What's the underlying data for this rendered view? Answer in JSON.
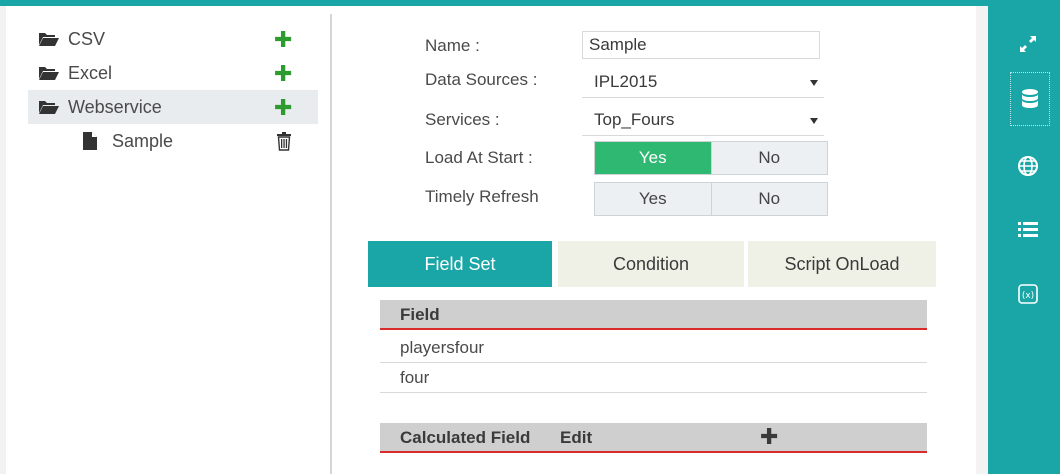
{
  "tree": {
    "items": [
      {
        "label": "CSV",
        "icon": "folder-open-icon"
      },
      {
        "label": "Excel",
        "icon": "folder-open-icon"
      },
      {
        "label": "Webservice",
        "icon": "folder-open-icon"
      },
      {
        "label": "Sample",
        "icon": "file-icon"
      }
    ],
    "add_icon": "plus-icon",
    "delete_icon": "trash-icon"
  },
  "form": {
    "name_label": "Name :",
    "name_value": "Sample",
    "datasource_label": "Data Sources :",
    "datasource_value": "IPL2015",
    "services_label": "Services :",
    "services_value": "Top_Fours",
    "load_label": "Load At Start :",
    "load_yes": "Yes",
    "load_no": "No",
    "load_selected": "Yes",
    "refresh_label": "Timely Refresh",
    "refresh_yes": "Yes",
    "refresh_no": "No",
    "refresh_selected": ""
  },
  "tabs": [
    {
      "label": "Field Set",
      "active": true
    },
    {
      "label": "Condition",
      "active": false
    },
    {
      "label": "Script OnLoad",
      "active": false
    }
  ],
  "fields": {
    "header": "Field",
    "rows": [
      "playersfour",
      "four"
    ]
  },
  "calculated": {
    "header": "Calculated Field",
    "edit": "Edit"
  },
  "sidebar_icons": [
    "expand-icon",
    "database-icon",
    "globe-icon",
    "list-icon",
    "variable-icon"
  ],
  "colors": {
    "accent": "#1aa6a6",
    "toggle_active": "#2eb872",
    "add_green": "#2e9b2e",
    "grid_underline": "#d92b2b"
  }
}
